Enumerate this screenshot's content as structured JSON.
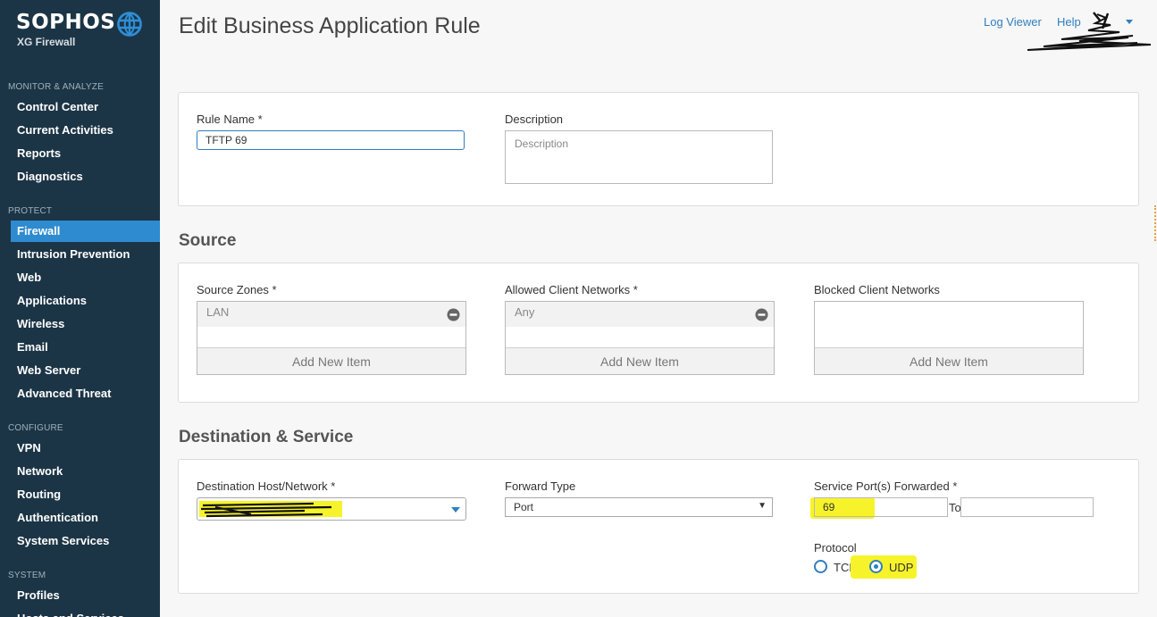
{
  "brand": {
    "name": "SOPHOS",
    "product": "XG Firewall"
  },
  "sidebar": {
    "sections": [
      {
        "title": "MONITOR & ANALYZE",
        "items": [
          "Control Center",
          "Current Activities",
          "Reports",
          "Diagnostics"
        ]
      },
      {
        "title": "PROTECT",
        "items": [
          "Firewall",
          "Intrusion Prevention",
          "Web",
          "Applications",
          "Wireless",
          "Email",
          "Web Server",
          "Advanced Threat"
        ]
      },
      {
        "title": "CONFIGURE",
        "items": [
          "VPN",
          "Network",
          "Routing",
          "Authentication",
          "System Services"
        ]
      },
      {
        "title": "SYSTEM",
        "items": [
          "Profiles",
          "Hosts and Services"
        ]
      }
    ],
    "active_item": "Firewall"
  },
  "header": {
    "title": "Edit Business Application Rule",
    "log_viewer": "Log Viewer",
    "help": "Help"
  },
  "rule": {
    "name_label": "Rule Name *",
    "name_value": "TFTP 69",
    "description_label": "Description",
    "description_placeholder": "Description"
  },
  "source": {
    "title": "Source",
    "zones_label": "Source Zones *",
    "zones_value": "LAN",
    "allowed_label": "Allowed Client Networks *",
    "allowed_value": "Any",
    "blocked_label": "Blocked Client Networks",
    "add_new": "Add New Item"
  },
  "destination": {
    "title": "Destination & Service",
    "host_label": "Destination Host/Network *",
    "forward_label": "Forward Type",
    "forward_value": "Port",
    "ports_label": "Service Port(s) Forwarded *",
    "port_value": "69",
    "to_label": "To",
    "protocol_label": "Protocol",
    "protocol_options": [
      "TCP",
      "UDP"
    ],
    "protocol_selected": "UDP"
  },
  "colors": {
    "sidebar": "#1c3546",
    "active": "#2e8bd0",
    "link": "#2f7fc0",
    "highlight": "#f7f32a"
  }
}
